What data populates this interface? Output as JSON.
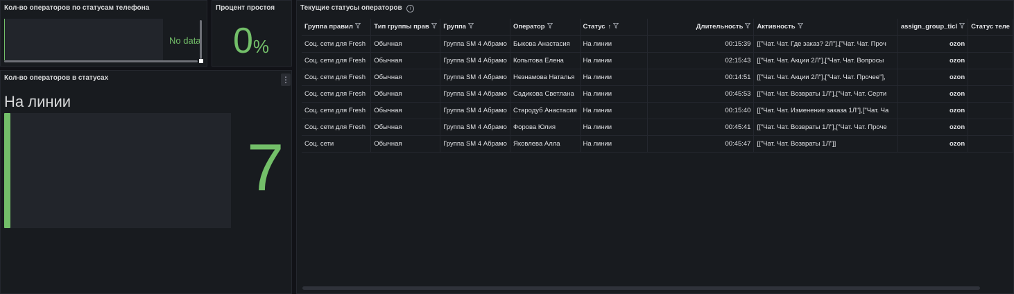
{
  "panel_phone_status": {
    "title": "Кол-во операторов по статусам телефона",
    "no_data": "No data"
  },
  "panel_idle": {
    "title": "Процент простоя",
    "value": "0",
    "unit": "%"
  },
  "panel_status_count": {
    "title": "Кол-во операторов в статусах",
    "menu_icon": "⋮",
    "label": "На линии",
    "value": "7"
  },
  "panel_table": {
    "title": "Текущие статусы операторов",
    "columns": [
      "Группа правил",
      "Тип группы прав",
      "Группа",
      "Оператор",
      "Статус",
      "Длительность",
      "Активность",
      "assign_group_ticl",
      "Статус теле"
    ],
    "rows": [
      [
        "Соц. сети для Fresh",
        "Обычная",
        "Группа SM 4 Абрамо",
        "Быкова Анастасия",
        "На линии",
        "00:15:39",
        "[[\"Чат. Чат. Где заказ? 2Л\"],[\"Чат. Чат. Проч",
        "ozon",
        ""
      ],
      [
        "Соц. сети для Fresh",
        "Обычная",
        "Группа SM 4 Абрамо",
        "Копытова Елена",
        "На линии",
        "02:15:43",
        "[[\"Чат. Чат. Акции 2Л\"],[\"Чат. Чат. Вопросы",
        "ozon",
        ""
      ],
      [
        "Соц. сети для Fresh",
        "Обычная",
        "Группа SM 4 Абрамо",
        "Незнамова Наталья",
        "На линии",
        "00:14:51",
        "[[\"Чат. Чат. Акции 2Л\"],[\"Чат. Чат. Прочее\"],",
        "ozon",
        ""
      ],
      [
        "Соц. сети для Fresh",
        "Обычная",
        "Группа SM 4 Абрамо",
        "Садикова Светлана",
        "На линии",
        "00:45:53",
        "[[\"Чат. Чат. Возвраты 1Л\"],[\"Чат. Чат. Серти",
        "ozon",
        ""
      ],
      [
        "Соц. сети для Fresh",
        "Обычная",
        "Группа SM 4 Абрамо",
        "Стародуб Анастасия",
        "На линии",
        "00:15:40",
        "[[\"Чат. Чат. Изменение заказа 1Л\"],[\"Чат. Ча",
        "ozon",
        ""
      ],
      [
        "Соц. сети для Fresh",
        "Обычная",
        "Группа SM 4 Абрамо",
        "Форова Юлия",
        "На линии",
        "00:45:41",
        "[[\"Чат. Чат. Возвраты 1Л\"],[\"Чат. Чат. Проче",
        "ozon",
        ""
      ],
      [
        "Соц. сети",
        "Обычная",
        "Группа SM 4 Абрамо",
        "Яковлева Алла",
        "На линии",
        "00:45:47",
        "[[\"Чат. Чат. Возвраты 1Л\"]]",
        "ozon",
        ""
      ]
    ],
    "sort_icon": "↑",
    "filter_icon": "funnel-icon"
  },
  "colors": {
    "accent_green": "#73bf69",
    "panel_bg": "#181b1f",
    "page_bg": "#111217"
  }
}
